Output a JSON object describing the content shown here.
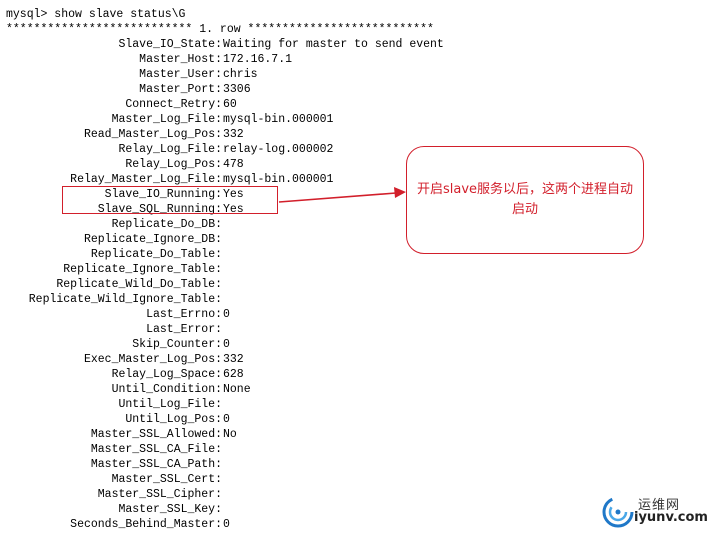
{
  "terminal": {
    "command": "mysql> show slave status\\G",
    "row_header": "*************************** 1. row ***************************",
    "fields": [
      {
        "name": "Slave_IO_State:",
        "value": "Waiting for master to send event"
      },
      {
        "name": "Master_Host:",
        "value": "172.16.7.1"
      },
      {
        "name": "Master_User:",
        "value": "chris"
      },
      {
        "name": "Master_Port:",
        "value": "3306"
      },
      {
        "name": "Connect_Retry:",
        "value": "60"
      },
      {
        "name": "Master_Log_File:",
        "value": "mysql-bin.000001"
      },
      {
        "name": "Read_Master_Log_Pos:",
        "value": "332"
      },
      {
        "name": "Relay_Log_File:",
        "value": "relay-log.000002"
      },
      {
        "name": "Relay_Log_Pos:",
        "value": "478"
      },
      {
        "name": "Relay_Master_Log_File:",
        "value": "mysql-bin.000001"
      },
      {
        "name": "Slave_IO_Running:",
        "value": "Yes"
      },
      {
        "name": "Slave_SQL_Running:",
        "value": "Yes"
      },
      {
        "name": "Replicate_Do_DB:",
        "value": ""
      },
      {
        "name": "Replicate_Ignore_DB:",
        "value": ""
      },
      {
        "name": "Replicate_Do_Table:",
        "value": ""
      },
      {
        "name": "Replicate_Ignore_Table:",
        "value": ""
      },
      {
        "name": "Replicate_Wild_Do_Table:",
        "value": ""
      },
      {
        "name": "Replicate_Wild_Ignore_Table:",
        "value": ""
      },
      {
        "name": "Last_Errno:",
        "value": "0"
      },
      {
        "name": "Last_Error:",
        "value": ""
      },
      {
        "name": "Skip_Counter:",
        "value": "0"
      },
      {
        "name": "Exec_Master_Log_Pos:",
        "value": "332"
      },
      {
        "name": "Relay_Log_Space:",
        "value": "628"
      },
      {
        "name": "Until_Condition:",
        "value": "None"
      },
      {
        "name": "Until_Log_File:",
        "value": ""
      },
      {
        "name": "Until_Log_Pos:",
        "value": "0"
      },
      {
        "name": "Master_SSL_Allowed:",
        "value": "No"
      },
      {
        "name": "Master_SSL_CA_File:",
        "value": ""
      },
      {
        "name": "Master_SSL_CA_Path:",
        "value": ""
      },
      {
        "name": "Master_SSL_Cert:",
        "value": ""
      },
      {
        "name": "Master_SSL_Cipher:",
        "value": ""
      },
      {
        "name": "Master_SSL_Key:",
        "value": ""
      },
      {
        "name": "Seconds_Behind_Master:",
        "value": "0"
      }
    ]
  },
  "annotation": {
    "callout_text": "开启slave服务以后，这两个进程自动启动",
    "accent_color": "#d21f2b"
  },
  "watermark": {
    "cn": "运维网",
    "en": "iyunv.com",
    "icon": "swirl-logo-icon"
  }
}
